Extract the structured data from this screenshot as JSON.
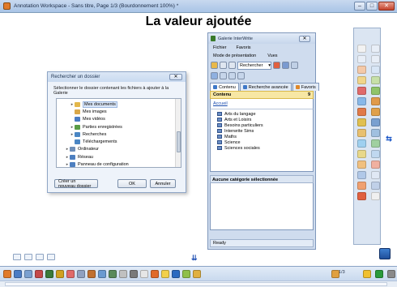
{
  "window": {
    "title": "Annotation Workspace - Sans titre, Page 1/3  (Bourdonnement 100%) *",
    "min_label": "–",
    "max_label": "□",
    "close_label": "✕"
  },
  "page": {
    "heading": "La valeur ajoutée"
  },
  "folder_dialog": {
    "title": "Rechercher un dossier",
    "close_label": "✕",
    "message": "Sélectionner le dossier contenant les fichiers à ajouter à la Galerie",
    "tree": [
      {
        "label": "Mes documents",
        "arrow": "▸",
        "indent": 10,
        "color": "#e3b74a",
        "selected": true
      },
      {
        "label": "Mes images",
        "arrow": "",
        "indent": 10,
        "color": "#d9a84a",
        "selected": false
      },
      {
        "label": "Mes vidéos",
        "arrow": "",
        "indent": 10,
        "color": "#4a7cc4",
        "selected": false
      },
      {
        "label": "Parties enregistrées",
        "arrow": "▸",
        "indent": 10,
        "color": "#5a9c46",
        "selected": false
      },
      {
        "label": "Recherches",
        "arrow": "▸",
        "indent": 10,
        "color": "#4a86c4",
        "selected": false
      },
      {
        "label": "Téléchargements",
        "arrow": "",
        "indent": 10,
        "color": "#4a86c4",
        "selected": false
      },
      {
        "label": "Ordinateur",
        "arrow": "▸",
        "indent": 4,
        "color": "#6e8fb9",
        "selected": false
      },
      {
        "label": "Réseau",
        "arrow": "▸",
        "indent": 4,
        "color": "#4d7fc0",
        "selected": false
      },
      {
        "label": "Panneau de configuration",
        "arrow": "▸",
        "indent": 4,
        "color": "#4d7fc0",
        "selected": false
      }
    ],
    "new_folder_label": "Créer un nouveau dossier",
    "ok_label": "OK",
    "cancel_label": "Annuler"
  },
  "gallery": {
    "title": "Galerie InterWrite",
    "close_label": "✕",
    "menu": [
      "Fichier",
      "Favoris"
    ],
    "menu2": [
      "Mode de présentation",
      "Vues"
    ],
    "search_label": "Rechercher",
    "tabs": [
      {
        "label": "Contenu",
        "color": "#3e78c8",
        "active": true
      },
      {
        "label": "Recherche avancée",
        "color": "#3e78c8",
        "active": false
      },
      {
        "label": "Favoris",
        "color": "#e0882a",
        "active": false
      }
    ],
    "content_label": "Contenu",
    "content_count": "9",
    "home_link": "Accueil",
    "categories": [
      "Arts du langage",
      "Arts et Loisirs",
      "Besoins particuliers",
      "Interwrite Sims",
      "Maths",
      "Science",
      "Sciences sociales"
    ],
    "no_category": "Aucune catégorie sélectionnée",
    "status": "Ready"
  },
  "toolbox": {
    "icon_colors": [
      "#f2f2f2",
      "#e8eef7",
      "#e8eef7",
      "#e8eef7",
      "#f4c9a8",
      "#d8e6f6",
      "#f0d58a",
      "#c7e0a8",
      "#e06a6a",
      "#8fc46a",
      "#88b8e8",
      "#e09a4a",
      "#e07a4a",
      "#e0a04a",
      "#e0c050",
      "#7aa0d0",
      "#e8c070",
      "#a0c0e0",
      "#9fd0f0",
      "#a0d0a0",
      "#e8d88a",
      "#c0d8f0",
      "#f0c080",
      "#f0b0a0",
      "#b0c8e8",
      "#e0e8f4",
      "#f0a070",
      "#c0d0e8",
      "#e06040",
      "#f0f0f0"
    ]
  },
  "side_arrow": "⇆",
  "double_arrow": "⇊",
  "bottom": {
    "page_indicator": "1/3",
    "icon_colors": [
      "#e07a2a",
      "#4a7cc4",
      "#7aa0d0",
      "#c44a4a",
      "#3a7a3a",
      "#d0a020",
      "#e06a6a",
      "#8fa0c0",
      "#c07030",
      "#6a9ad0",
      "#5a8a5a",
      "#c0c0c0",
      "#7a7a7a",
      "#e6e6e6",
      "#e06a2a",
      "#f2d04a",
      "#2a6ac0",
      "#8fbf4a",
      "#e0b040"
    ],
    "right_icons": [
      "#e0a040",
      "#f0c030",
      "#2a9a3a",
      "#8a8a8a"
    ]
  }
}
